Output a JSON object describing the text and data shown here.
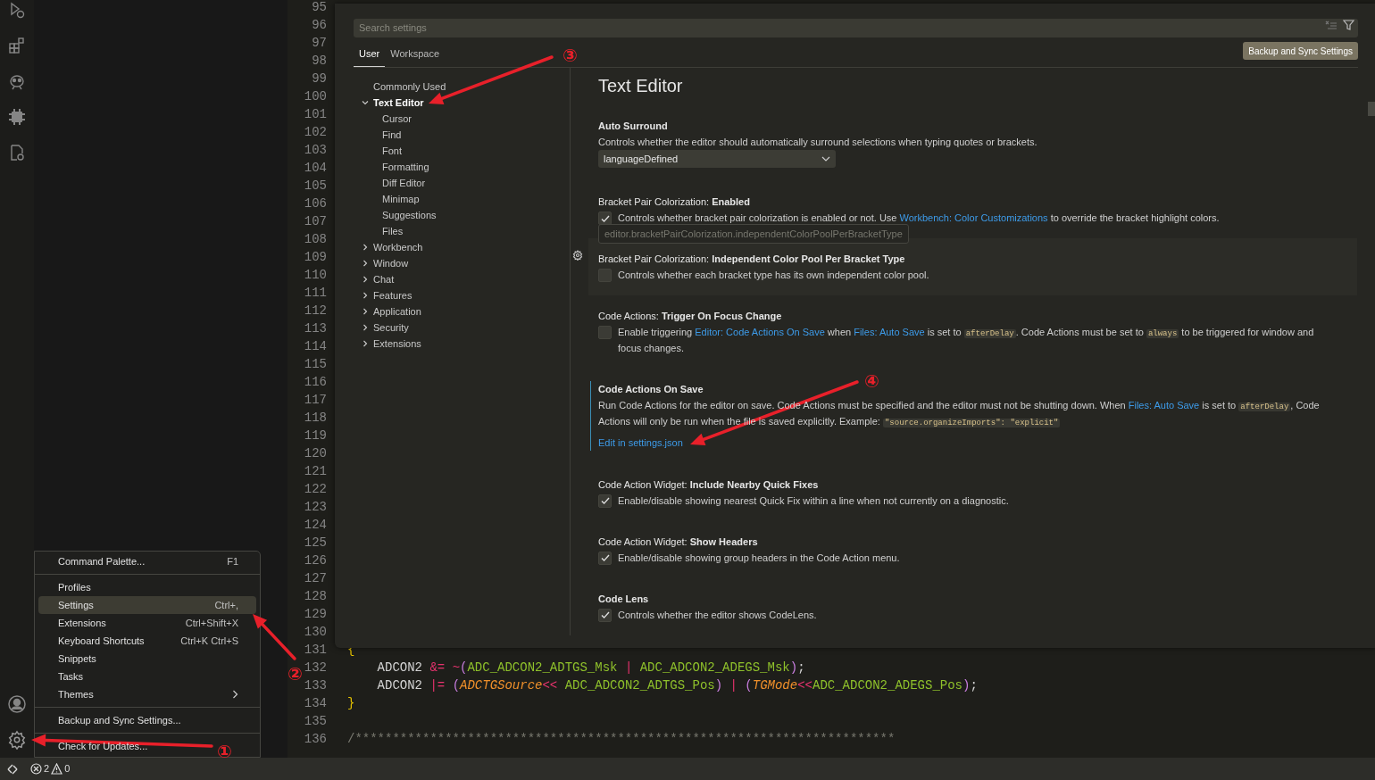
{
  "editor": {
    "lines": [
      {
        "number": "95"
      },
      {
        "number": "96"
      },
      {
        "number": "97"
      },
      {
        "number": "98"
      },
      {
        "number": "99"
      },
      {
        "number": "100"
      },
      {
        "number": "101"
      },
      {
        "number": "102"
      },
      {
        "number": "103"
      },
      {
        "number": "104"
      },
      {
        "number": "105"
      },
      {
        "number": "106"
      },
      {
        "number": "107"
      },
      {
        "number": "108"
      },
      {
        "number": "109"
      },
      {
        "number": "110"
      },
      {
        "number": "111"
      },
      {
        "number": "112"
      },
      {
        "number": "113"
      },
      {
        "number": "114"
      },
      {
        "number": "115"
      },
      {
        "number": "116"
      },
      {
        "number": "117"
      },
      {
        "number": "118"
      },
      {
        "number": "119"
      },
      {
        "number": "120"
      },
      {
        "number": "121"
      },
      {
        "number": "122"
      },
      {
        "number": "123"
      },
      {
        "number": "124"
      },
      {
        "number": "125"
      },
      {
        "number": "126"
      },
      {
        "number": "127"
      },
      {
        "number": "128"
      },
      {
        "number": "129"
      },
      {
        "number": "130"
      },
      {
        "number": "131",
        "tokens": [
          {
            "kind": "brace",
            "text": "{"
          }
        ]
      },
      {
        "number": "132",
        "tokens": [
          {
            "kind": "plain",
            "text": "    ADCON2 "
          },
          {
            "kind": "op",
            "text": "&= ~"
          },
          {
            "kind": "paren",
            "text": "("
          },
          {
            "kind": "macro",
            "text": "ADC_ADCON2_ADTGS_Msk "
          },
          {
            "kind": "op",
            "text": "| "
          },
          {
            "kind": "macro",
            "text": "ADC_ADCON2_ADEGS_Msk"
          },
          {
            "kind": "paren",
            "text": ")"
          },
          {
            "kind": "plain",
            "text": ";"
          }
        ]
      },
      {
        "number": "133",
        "tokens": [
          {
            "kind": "plain",
            "text": "    ADCON2 "
          },
          {
            "kind": "op",
            "text": "|= "
          },
          {
            "kind": "paren",
            "text": "("
          },
          {
            "kind": "param",
            "text": "ADCTGSource"
          },
          {
            "kind": "op",
            "text": "<< "
          },
          {
            "kind": "macro",
            "text": "ADC_ADCON2_ADTGS_Pos"
          },
          {
            "kind": "paren",
            "text": ") "
          },
          {
            "kind": "op",
            "text": "| "
          },
          {
            "kind": "paren",
            "text": "("
          },
          {
            "kind": "param",
            "text": "TGMode"
          },
          {
            "kind": "op",
            "text": "<<"
          },
          {
            "kind": "macro",
            "text": "ADC_ADCON2_ADEGS_Pos"
          },
          {
            "kind": "paren",
            "text": ")"
          },
          {
            "kind": "plain",
            "text": ";"
          }
        ]
      },
      {
        "number": "134",
        "tokens": [
          {
            "kind": "brace",
            "text": "}"
          }
        ]
      },
      {
        "number": "135"
      },
      {
        "number": "136",
        "tokens": [
          {
            "kind": "comment",
            "text": "/************************************************************************"
          }
        ]
      }
    ]
  },
  "settings": {
    "search": {
      "placeholder": "Search settings"
    },
    "tabs": [
      {
        "label": "User",
        "selected": true
      },
      {
        "label": "Workspace",
        "selected": false
      }
    ],
    "sync_button": "Backup and Sync Settings",
    "toc": [
      {
        "label": "Commonly Used",
        "selected": false
      },
      {
        "label": "Text Editor",
        "selected": true,
        "expanded": true,
        "children": [
          {
            "label": "Cursor",
            "selected": false
          },
          {
            "label": "Find",
            "selected": false
          },
          {
            "label": "Font",
            "selected": false
          },
          {
            "label": "Formatting",
            "selected": false
          },
          {
            "label": "Diff Editor",
            "selected": false
          },
          {
            "label": "Minimap",
            "selected": false
          },
          {
            "label": "Suggestions",
            "selected": false
          },
          {
            "label": "Files",
            "selected": false
          }
        ]
      },
      {
        "label": "Workbench",
        "selected": false,
        "expanded": false
      },
      {
        "label": "Window",
        "selected": false,
        "expanded": false
      },
      {
        "label": "Chat",
        "selected": false,
        "expanded": false
      },
      {
        "label": "Features",
        "selected": false,
        "expanded": false
      },
      {
        "label": "Application",
        "selected": false,
        "expanded": false
      },
      {
        "label": "Security",
        "selected": false,
        "expanded": false
      },
      {
        "label": "Extensions",
        "selected": false,
        "expanded": false
      }
    ],
    "heading": "Text Editor",
    "items": [
      {
        "kind": "dropdown",
        "name": "Auto Surround",
        "description": [
          {
            "kind": "text",
            "text": "Controls whether the editor should automatically surround selections when typing quotes or brackets."
          }
        ],
        "value": "languageDefined"
      },
      {
        "kind": "checkbox",
        "category": "Bracket Pair Colorization: ",
        "name": "Enabled",
        "checked": true,
        "description": [
          {
            "kind": "text",
            "text": "Controls whether bracket pair colorization is enabled or not. Use "
          },
          {
            "kind": "link",
            "text": "Workbench: Color Customizations"
          },
          {
            "kind": "text",
            "text": " to override the bracket highlight colors."
          }
        ]
      },
      {
        "kind": "checkbox",
        "category": "Bracket Pair Colorization: ",
        "name": "Independent Color Pool Per Bracket Type",
        "hovered": true,
        "key_hint": "editor.bracketPairColorization.independentColorPoolPerBracketType",
        "checked": false,
        "description": [
          {
            "kind": "text",
            "text": "Controls whether each bracket type has its own independent color pool."
          }
        ]
      },
      {
        "kind": "checkbox",
        "category": "Code Actions: ",
        "name": "Trigger On Focus Change",
        "checked": false,
        "description": [
          {
            "kind": "text",
            "text": "Enable triggering "
          },
          {
            "kind": "link",
            "text": "Editor: Code Actions On Save"
          },
          {
            "kind": "text",
            "text": " when "
          },
          {
            "kind": "link",
            "text": "Files: Auto Save"
          },
          {
            "kind": "text",
            "text": " is set to "
          },
          {
            "kind": "code",
            "text": "afterDelay"
          },
          {
            "kind": "text",
            "text": ". Code Actions must be set to "
          },
          {
            "kind": "code",
            "text": "always"
          },
          {
            "kind": "text",
            "text": " to be triggered for window and focus changes."
          }
        ]
      },
      {
        "kind": "json",
        "name": "Code Actions On Save",
        "focused": true,
        "description": [
          {
            "kind": "text",
            "text": "Run Code Actions for the editor on save. Code Actions must be specified and the editor must not be shutting down. When "
          },
          {
            "kind": "link",
            "text": "Files: Auto Save"
          },
          {
            "kind": "text",
            "text": " is set to "
          },
          {
            "kind": "code",
            "text": "afterDelay"
          },
          {
            "kind": "text",
            "text": ", Code Actions will only be run when the file is saved explicitly. Example: "
          },
          {
            "kind": "code",
            "text": "\"source.organizeImports\": \"explicit\""
          }
        ],
        "link": "Edit in settings.json"
      },
      {
        "kind": "checkbox",
        "category": "Code Action Widget: ",
        "name": "Include Nearby Quick Fixes",
        "checked": true,
        "description": [
          {
            "kind": "text",
            "text": "Enable/disable showing nearest Quick Fix within a line when not currently on a diagnostic."
          }
        ]
      },
      {
        "kind": "checkbox",
        "category": "Code Action Widget: ",
        "name": "Show Headers",
        "checked": true,
        "description": [
          {
            "kind": "text",
            "text": "Enable/disable showing group headers in the Code Action menu."
          }
        ]
      },
      {
        "kind": "checkbox",
        "name": "Code Lens",
        "checked": true,
        "description": [
          {
            "kind": "text",
            "text": "Controls whether the editor shows CodeLens."
          }
        ]
      }
    ]
  },
  "menu": [
    {
      "items": [
        {
          "label": "Command Palette...",
          "shortcut": "F1",
          "selected": false
        }
      ]
    },
    {
      "items": [
        {
          "label": "Profiles",
          "selected": false
        },
        {
          "label": "Settings",
          "shortcut": "Ctrl+,",
          "selected": true
        },
        {
          "label": "Extensions",
          "shortcut": "Ctrl+Shift+X",
          "selected": false
        },
        {
          "label": "Keyboard Shortcuts",
          "shortcut": "Ctrl+K Ctrl+S",
          "selected": false
        },
        {
          "label": "Snippets",
          "selected": false
        },
        {
          "label": "Tasks",
          "selected": false
        },
        {
          "label": "Themes",
          "selected": false,
          "submenu": true
        }
      ]
    },
    {
      "items": [
        {
          "label": "Backup and Sync Settings...",
          "selected": false
        }
      ]
    },
    {
      "items": [
        {
          "label": "Check for Updates...",
          "selected": false
        }
      ]
    }
  ],
  "status_bar": {
    "errors": "2",
    "warnings": "0"
  },
  "annotations": [
    {
      "label": "①"
    },
    {
      "label": "②"
    },
    {
      "label": "③"
    },
    {
      "label": "④"
    }
  ]
}
